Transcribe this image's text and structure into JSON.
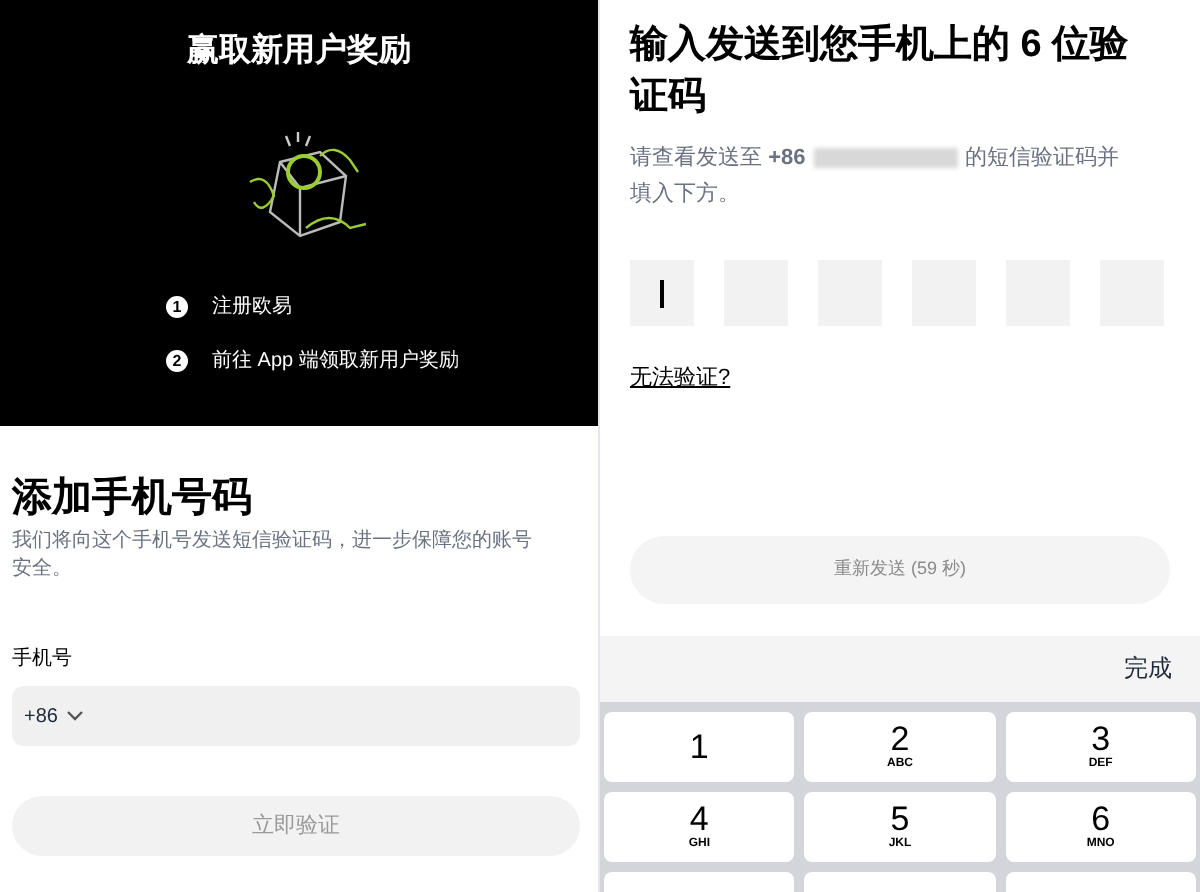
{
  "reward_panel": {
    "title": "赢取新用户奖励",
    "steps": [
      {
        "number": "1",
        "text": "注册欧易"
      },
      {
        "number": "2",
        "text": "前往 App 端领取新用户奖励"
      }
    ]
  },
  "phone_form": {
    "title": "添加手机号码",
    "description": "我们将向这个手机号发送短信验证码，进一步保障您的账号安全。",
    "field_label": "手机号",
    "country_code": "+86",
    "button": "立即验证",
    "button_disabled": true
  },
  "verify_form": {
    "title": "输入发送到您手机上的 6 位验证码",
    "hint_before": "请查看发送至 **+86**",
    "hint_after": "的短信验证码并",
    "hint_end": "填入下方。",
    "code_boxes": [
      {
        "focused": true
      },
      {
        "focused": false
      },
      {
        "focused": false
      },
      {
        "focused": false
      },
      {
        "focused": false
      },
      {
        "focused": false
      }
    ],
    "help_link": "无法验证?",
    "resend_button": "重新发送 (59 秒)",
    "resend_disabled": true
  },
  "keyboard": {
    "done": "完成",
    "keys": [
      {
        "digit": "1"
      },
      {
        "digit": "2",
        "letters": "ABC"
      },
      {
        "digit": "3",
        "letters": "DEF"
      },
      {
        "digit": "4",
        "letters": "GHI"
      },
      {
        "digit": "5",
        "letters": "JKL"
      },
      {
        "digit": "6",
        "letters": "MNO"
      }
    ]
  }
}
